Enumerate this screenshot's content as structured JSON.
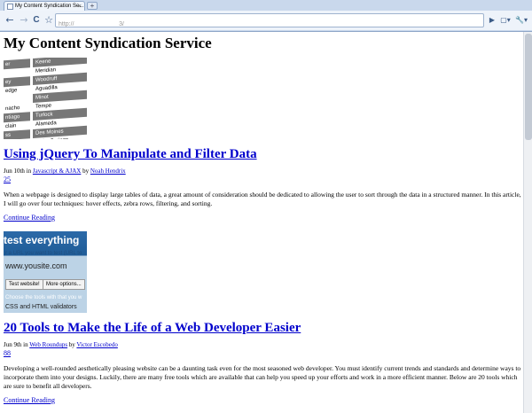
{
  "browser": {
    "tab_title": "My Content Syndication Se...",
    "tab_close": "×",
    "new_tab": "+",
    "back_icon": "←",
    "forward_icon": "→",
    "reload_icon": "C",
    "star_icon": "☆",
    "url": "http://                          3/",
    "go_icon": "▶",
    "page_menu_icon": "▢▾",
    "wrench_icon": "🔧▾"
  },
  "site": {
    "title": "My Content Syndication Service"
  },
  "thumb1_rows": [
    {
      "c1": "er",
      "c2": "Keene",
      "dark": true
    },
    {
      "c1": "",
      "c2": "Meridian",
      "dark": false
    },
    {
      "c1": "ey",
      "c2": "Woodruff",
      "dark": true
    },
    {
      "c1": "edge",
      "c2": "Aguadilla",
      "dark": false
    },
    {
      "c1": "",
      "c2": "Minot",
      "dark": true
    },
    {
      "c1": "nacho",
      "c2": "Tempe",
      "dark": false
    },
    {
      "c1": "ntiago",
      "c2": "Turlock",
      "dark": true
    },
    {
      "c1": "clain",
      "c2": "Alameda",
      "dark": false
    },
    {
      "c1": "ss",
      "c2": "Des Moines",
      "dark": true
    },
    {
      "c1": "",
      "c2": "Idaho Springs",
      "dark": false
    }
  ],
  "thumb2": {
    "banner": "test everything",
    "line1": "r a URL you want to test (URL to",
    "line2": "www.yousite.com",
    "btn1": "Test website!",
    "btn2": "More options...",
    "line3": "Choose the tools with that you w",
    "line4": "CSS and HTML validators"
  },
  "posts": [
    {
      "title": "Using jQuery To Manipulate and Filter Data",
      "date_prefix": "Jun 10th in ",
      "category": "Javascript & AJAX",
      "by": " by ",
      "author": "Noah Hendrix",
      "comments": "25",
      "excerpt": "When a webpage is designed to display large tables of data, a great amount of consideration should be dedicated to allowing the user to sort through the data in a structured manner. In this article, I will go over four techniques: hover effects, zebra rows, filtering, and sorting.",
      "more": "Continue Reading"
    },
    {
      "title": "20 Tools to Make the Life of a Web Developer Easier",
      "date_prefix": "Jun 9th in ",
      "category": "Web Roundups",
      "by": " by ",
      "author": "Victor Escobedo",
      "comments": "88",
      "excerpt": "Developing a well-rounded aesthetically pleasing website can be a daunting task even for the most seasoned web developer. You must identify current trends and standards and determine ways to incorporate them into your designs. Luckily, there are many free tools which are available that can help you speed up your efforts and work in a more efficient manner. Below are 20 tools which are sure to benefit all developers.",
      "more": "Continue Reading"
    }
  ]
}
